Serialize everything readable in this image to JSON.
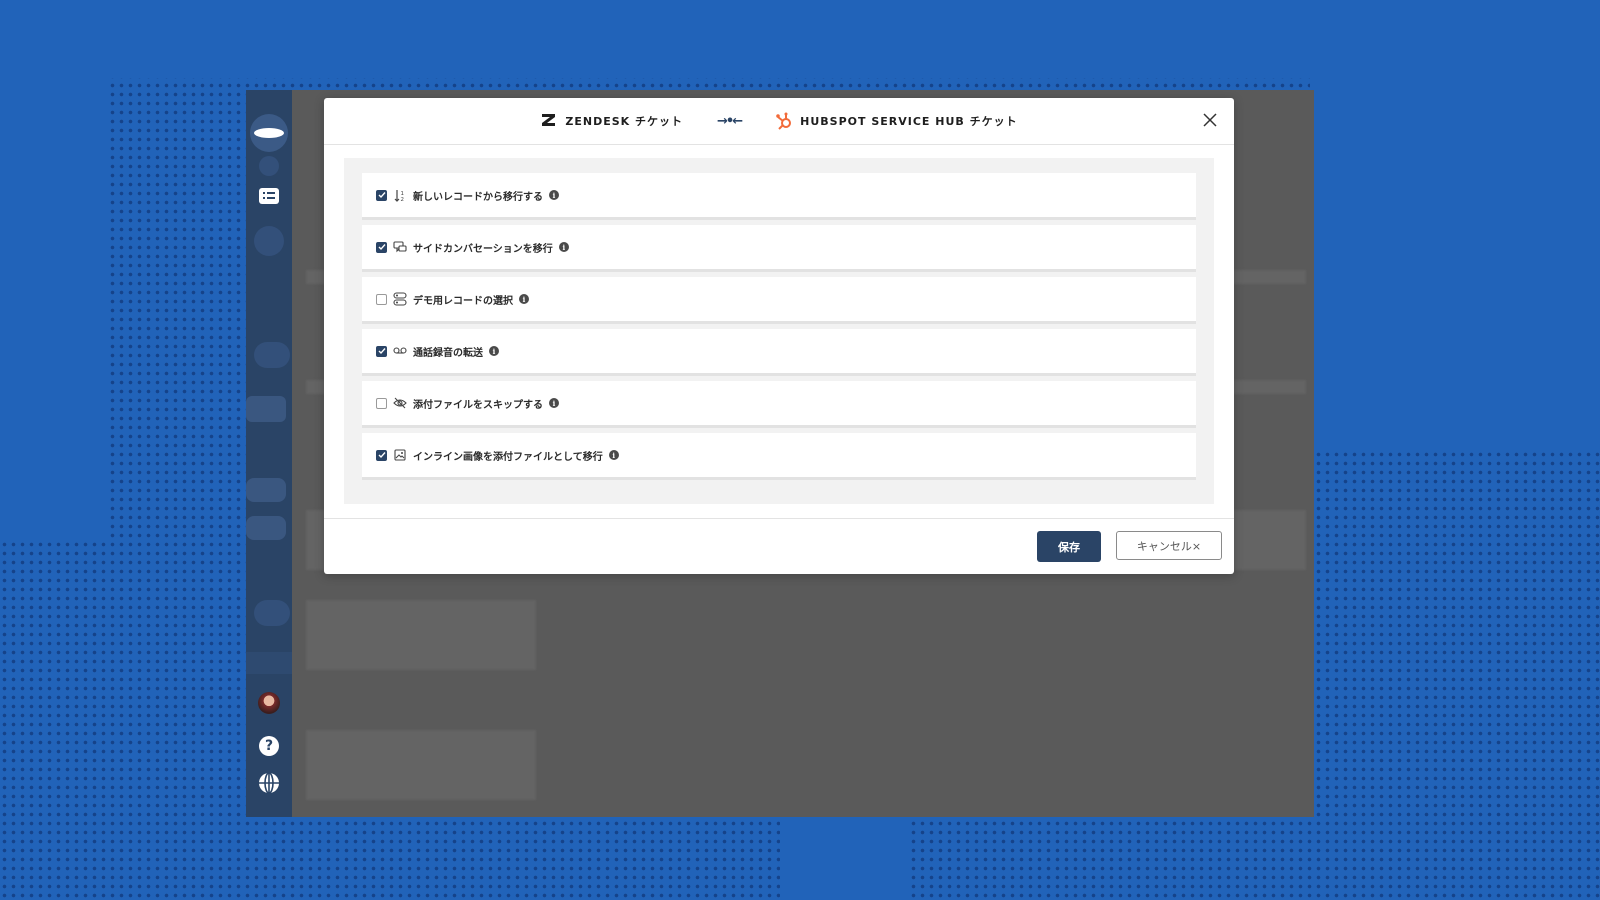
{
  "colors": {
    "background": "#2163b9",
    "sidebar": "#2a4466",
    "accent": "#2a4466",
    "hubspot_orange": "#f26b3a"
  },
  "sidebar": {
    "icons": [
      "logo-icon",
      "list-icon",
      "avatar",
      "help-icon",
      "globe-icon"
    ]
  },
  "modal": {
    "source_label": "ZENDESK チケット",
    "source_logo_sub": "zendesk",
    "target_label": "HUBSPOT SERVICE HUB チケット",
    "transfer_symbol": "→•←",
    "options": [
      {
        "label": "新しいレコードから移行する",
        "checked": true,
        "icon": "sort-icon"
      },
      {
        "label": "サイドカンバセーションを移行",
        "checked": true,
        "icon": "conversation-icon"
      },
      {
        "label": "デモ用レコードの選択",
        "checked": false,
        "icon": "records-icon"
      },
      {
        "label": "通話録音の転送",
        "checked": true,
        "icon": "voicemail-icon"
      },
      {
        "label": "添付ファイルをスキップする",
        "checked": false,
        "icon": "eye-off-icon"
      },
      {
        "label": "インライン画像を添付ファイルとして移行",
        "checked": true,
        "icon": "image-icon"
      }
    ],
    "save_label": "保存",
    "cancel_label": "キャンセル×"
  }
}
